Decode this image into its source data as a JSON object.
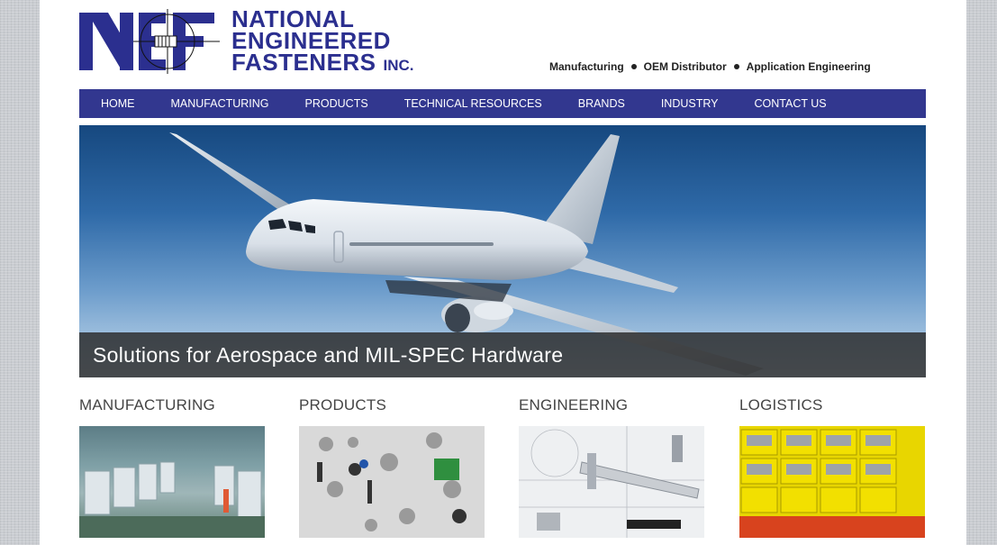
{
  "brand": {
    "line1": "NATIONAL",
    "line2": "ENGINEERED",
    "line3": "FASTENERS",
    "inc": "INC.",
    "colors": {
      "primary": "#2b2f8f",
      "nav": "#32378f"
    }
  },
  "tagline": {
    "items": [
      "Manufacturing",
      "OEM Distributor",
      "Application Engineering"
    ]
  },
  "nav": {
    "items": [
      {
        "label": "HOME"
      },
      {
        "label": "MANUFACTURING"
      },
      {
        "label": "PRODUCTS"
      },
      {
        "label": "TECHNICAL RESOURCES"
      },
      {
        "label": "BRANDS"
      },
      {
        "label": "INDUSTRY"
      },
      {
        "label": "CONTACT US"
      }
    ]
  },
  "hero": {
    "caption": "Solutions for Aerospace and MIL-SPEC Hardware"
  },
  "categories": [
    {
      "title": "MANUFACTURING"
    },
    {
      "title": "PRODUCTS"
    },
    {
      "title": "ENGINEERING"
    },
    {
      "title": "LOGISTICS"
    }
  ]
}
